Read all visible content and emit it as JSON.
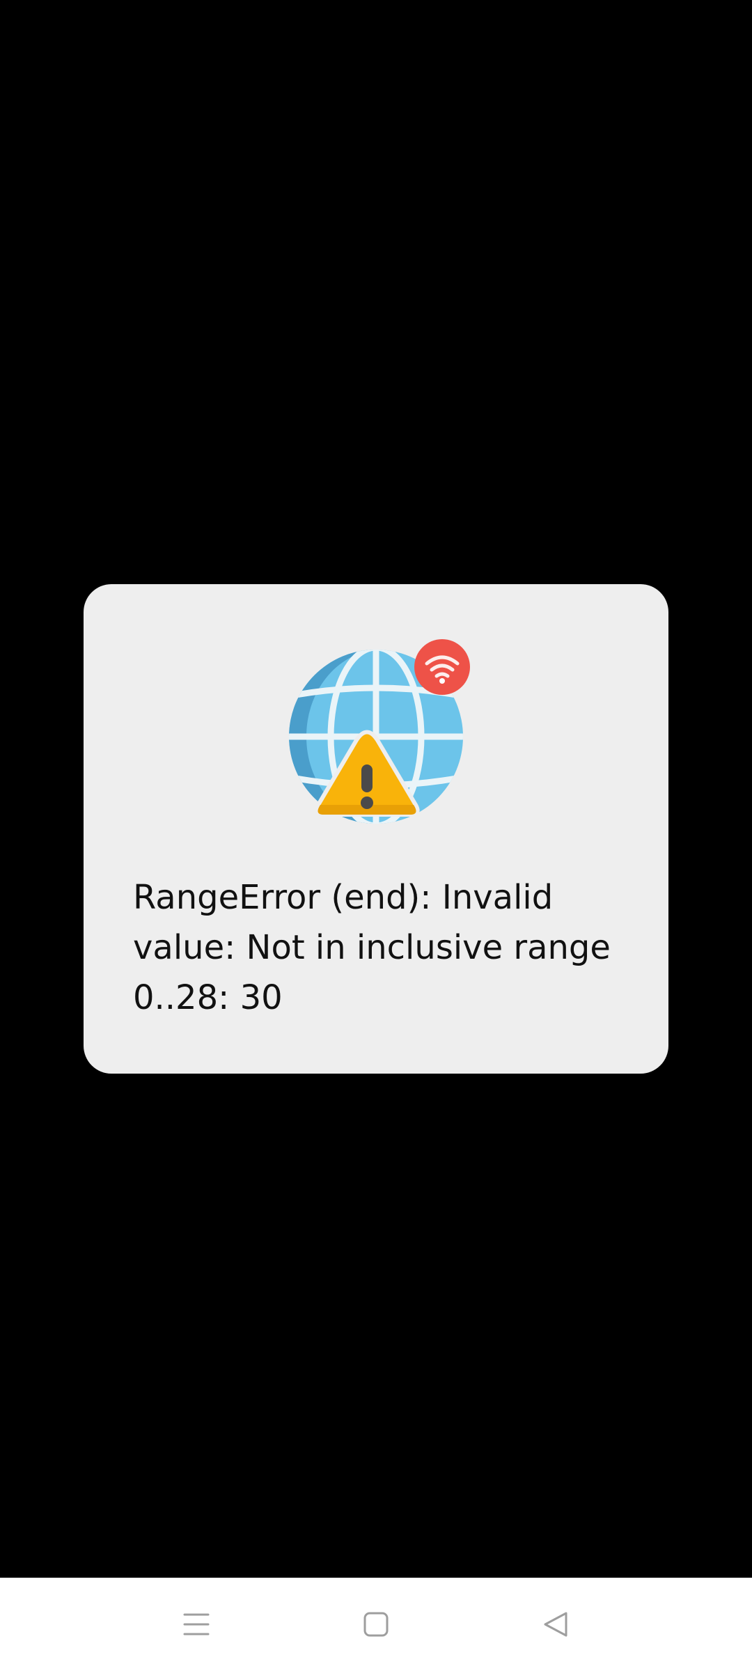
{
  "dialog": {
    "illustration_icon": "globe-warning-wifi-icon",
    "message": "RangeError (end): Invalid value: Not in inclusive range 0..28: 30"
  },
  "nav_bar": {
    "buttons": [
      {
        "icon": "menu-icon"
      },
      {
        "icon": "home-square-icon"
      },
      {
        "icon": "back-triangle-icon"
      }
    ]
  },
  "colors": {
    "background": "#000000",
    "dialog_background": "#eeeeee",
    "globe_blue": "#6cc4ea",
    "globe_dark": "#4a9ecb",
    "warning_yellow": "#f9b30a",
    "badge_red": "#ee5248",
    "nav_bar": "#ffffff"
  }
}
